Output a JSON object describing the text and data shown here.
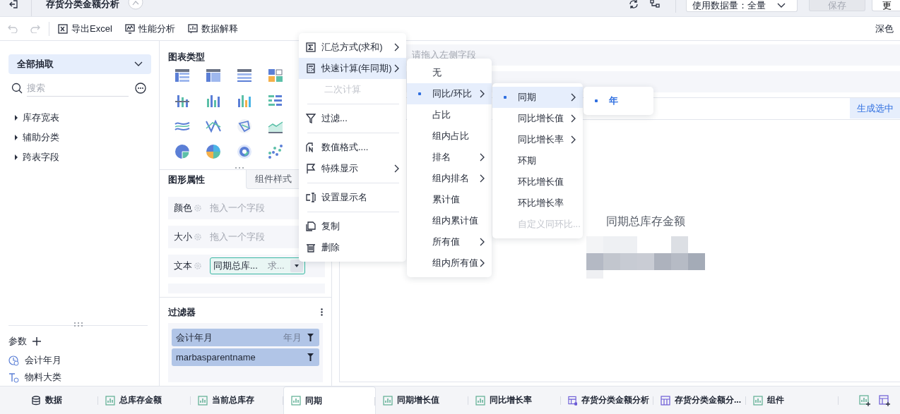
{
  "header": {
    "title": "存货分类金额分析",
    "data_volume": "使用数据量：全量",
    "save_button": {
      "label": "保存",
      "disabled": true
    },
    "more_button": "更"
  },
  "toolbar": {
    "undo_disabled": true,
    "redo_disabled": true,
    "items": [
      {
        "label": "导出Excel",
        "kind": "excel"
      },
      {
        "label": "性能分析",
        "kind": "performance"
      },
      {
        "label": "数据解释",
        "kind": "explain"
      }
    ],
    "theme": "深色"
  },
  "left_panel": {
    "dataset": "全部抽取",
    "search_placeholder": "搜索",
    "tree": [
      {
        "label": "库存宽表",
        "expanded": false
      },
      {
        "label": "辅助分类",
        "expanded": false
      },
      {
        "label": "跨表字段",
        "expanded": false
      }
    ],
    "params_title": "参数",
    "params": [
      {
        "label": "会计年月",
        "kind": "date"
      },
      {
        "label": "物料大类",
        "kind": "text"
      }
    ]
  },
  "chart_types": {
    "title": "图表类型"
  },
  "properties": {
    "tabs": [
      {
        "label": "图形属性",
        "selected": true
      },
      {
        "label": "组件样式",
        "selected": false
      }
    ],
    "rows": [
      {
        "label": "颜色",
        "placeholder": "拖入一个字段"
      },
      {
        "label": "大小",
        "placeholder": "拖入一个字段"
      },
      {
        "label": "文本",
        "field": {
          "name": "同期总库...",
          "aggregation": "求..."
        }
      }
    ]
  },
  "filters": {
    "title": "过滤器",
    "items": [
      {
        "name": "会计年月",
        "tag": "年月"
      },
      {
        "name": "marbasparentname"
      }
    ]
  },
  "canvas": {
    "field_placeholder": "请拖入左侧字段",
    "generate_button": "生成选中",
    "chart_title": "同期总库存金额"
  },
  "context_menus": [
    [
      {
        "label": "汇总方式(求和)",
        "kind": "sum",
        "submenu": true,
        "disabled": false,
        "selected": false,
        "divider_after": false
      },
      {
        "label": "快速计算(年同期)",
        "kind": "calculator",
        "submenu": true,
        "disabled": false,
        "selected": true,
        "divider_after": false
      },
      {
        "label": "二次计算",
        "kind": "none",
        "submenu": false,
        "disabled": true,
        "selected": false,
        "divider_after": true
      },
      {
        "label": "过滤...",
        "kind": "filter",
        "submenu": false,
        "disabled": false,
        "selected": false,
        "divider_after": true
      },
      {
        "label": "数值格式....",
        "kind": "format",
        "submenu": false,
        "disabled": false,
        "selected": false,
        "divider_after": false
      },
      {
        "label": "特殊显示",
        "kind": "flag",
        "submenu": true,
        "disabled": false,
        "selected": false,
        "divider_after": true
      },
      {
        "label": "设置显示名",
        "kind": "rename",
        "submenu": false,
        "disabled": false,
        "selected": false,
        "divider_after": true
      },
      {
        "label": "复制",
        "kind": "copy",
        "submenu": false,
        "disabled": false,
        "selected": false,
        "divider_after": false
      },
      {
        "label": "删除",
        "kind": "delete",
        "submenu": false,
        "disabled": false,
        "selected": false,
        "divider_after": false
      }
    ],
    [
      {
        "label": "无",
        "submenu": false,
        "disabled": false,
        "selected": false,
        "current": false
      },
      {
        "label": "同比/环比",
        "submenu": true,
        "disabled": false,
        "selected": true,
        "current": true
      },
      {
        "label": "占比",
        "submenu": false,
        "disabled": false,
        "selected": false,
        "current": false
      },
      {
        "label": "组内占比",
        "submenu": false,
        "disabled": false,
        "selected": false,
        "current": false
      },
      {
        "label": "排名",
        "submenu": true,
        "disabled": false,
        "selected": false,
        "current": false
      },
      {
        "label": "组内排名",
        "submenu": true,
        "disabled": false,
        "selected": false,
        "current": false
      },
      {
        "label": "累计值",
        "submenu": false,
        "disabled": false,
        "selected": false,
        "current": false
      },
      {
        "label": "组内累计值",
        "submenu": false,
        "disabled": false,
        "selected": false,
        "current": false
      },
      {
        "label": "所有值",
        "submenu": true,
        "disabled": false,
        "selected": false,
        "current": false
      },
      {
        "label": "组内所有值",
        "submenu": true,
        "disabled": false,
        "selected": false,
        "current": false
      }
    ],
    [
      {
        "label": "同期",
        "submenu": true,
        "disabled": false,
        "selected": true,
        "current": true
      },
      {
        "label": "同比增长值",
        "submenu": true,
        "disabled": false,
        "selected": false,
        "current": false
      },
      {
        "label": "同比增长率",
        "submenu": true,
        "disabled": false,
        "selected": false,
        "current": false
      },
      {
        "label": "环期",
        "submenu": false,
        "disabled": false,
        "selected": false,
        "current": false
      },
      {
        "label": "环比增长值",
        "submenu": false,
        "disabled": false,
        "selected": false,
        "current": false
      },
      {
        "label": "环比增长率",
        "submenu": false,
        "disabled": false,
        "selected": false,
        "current": false
      },
      {
        "label": "自定义同环比...",
        "submenu": false,
        "disabled": true,
        "selected": false,
        "current": false
      }
    ],
    [
      {
        "label": "年",
        "submenu": false,
        "disabled": false,
        "selected": false,
        "current": true
      }
    ]
  ],
  "bottom_tabs": [
    {
      "label": "数据",
      "kind": "data",
      "selected": false
    },
    {
      "label": "总库存金额",
      "kind": "chart",
      "selected": false
    },
    {
      "label": "当前总库存",
      "kind": "chart",
      "selected": false
    },
    {
      "label": "同期",
      "kind": "chart",
      "selected": true
    },
    {
      "label": "同期增长值",
      "kind": "chart",
      "selected": false
    },
    {
      "label": "同比增长率",
      "kind": "chart",
      "selected": false
    },
    {
      "label": "存货分类金额分析",
      "kind": "dashboard",
      "selected": false
    },
    {
      "label": "存货分类金额分...",
      "kind": "report",
      "selected": false
    },
    {
      "label": "组件",
      "kind": "component",
      "selected": false
    }
  ]
}
